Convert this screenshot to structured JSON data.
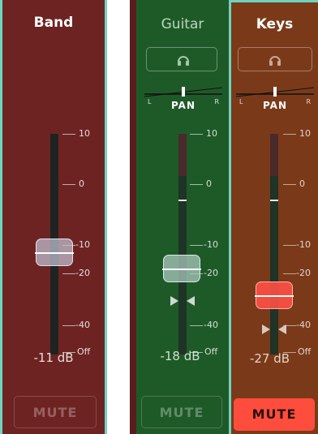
{
  "scale": {
    "ticks": [
      "10",
      "0",
      "-10",
      "-20",
      "-40",
      "Off"
    ]
  },
  "channels": [
    {
      "name": "Band",
      "db_readout": "-11 dB",
      "fader_db": -11,
      "mute_label": "MUTE",
      "mute_active": false,
      "color": "#6e2323"
    },
    {
      "name": "Guitar",
      "db_readout": "-18 dB",
      "fader_db": -18,
      "pan_label": "PAN",
      "pan_left": "L",
      "pan_right": "R",
      "mute_label": "MUTE",
      "mute_active": false,
      "color": "#1e5a28",
      "icons": {
        "monitor": "headphones-icon"
      }
    },
    {
      "name": "Keys",
      "db_readout": "-27 dB",
      "fader_db": -27,
      "pan_label": "PAN",
      "pan_left": "L",
      "pan_right": "R",
      "mute_label": "MUTE",
      "mute_active": true,
      "color": "#7a3a19",
      "mute_active_color": "#ff4d3d",
      "icons": {
        "monitor": "headphones-icon"
      }
    }
  ]
}
